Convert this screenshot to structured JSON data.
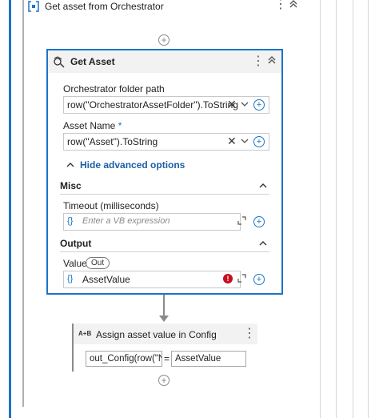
{
  "sequence": {
    "title": "Get asset from Orchestrator",
    "more_icon": "more-vertical-icon",
    "collapse_icon": "chevron-double-up-icon"
  },
  "get_asset": {
    "title": "Get Asset",
    "icon": "asset-key-icon",
    "folder_label": "Orchestrator folder path",
    "folder_value": "row(\"OrchestratorAssetFolder\").ToString",
    "asset_name_label": "Asset Name",
    "asset_name_required": "*",
    "asset_name_value": "row(\"Asset\").ToString",
    "advanced_toggle": "Hide advanced options",
    "misc_title": "Misc",
    "timeout_label": "Timeout (milliseconds)",
    "timeout_placeholder": "Enter a VB expression",
    "output_title": "Output",
    "value_label": "Value",
    "value_badge": "Out",
    "value_field": "AssetValue",
    "brace": "{}",
    "error_mark": "!"
  },
  "assign": {
    "icon_text": "A+B",
    "title": "Assign asset value in Config",
    "left_value": "out_Config(row(\"N",
    "equals": "=",
    "right_value": "AssetValue"
  }
}
